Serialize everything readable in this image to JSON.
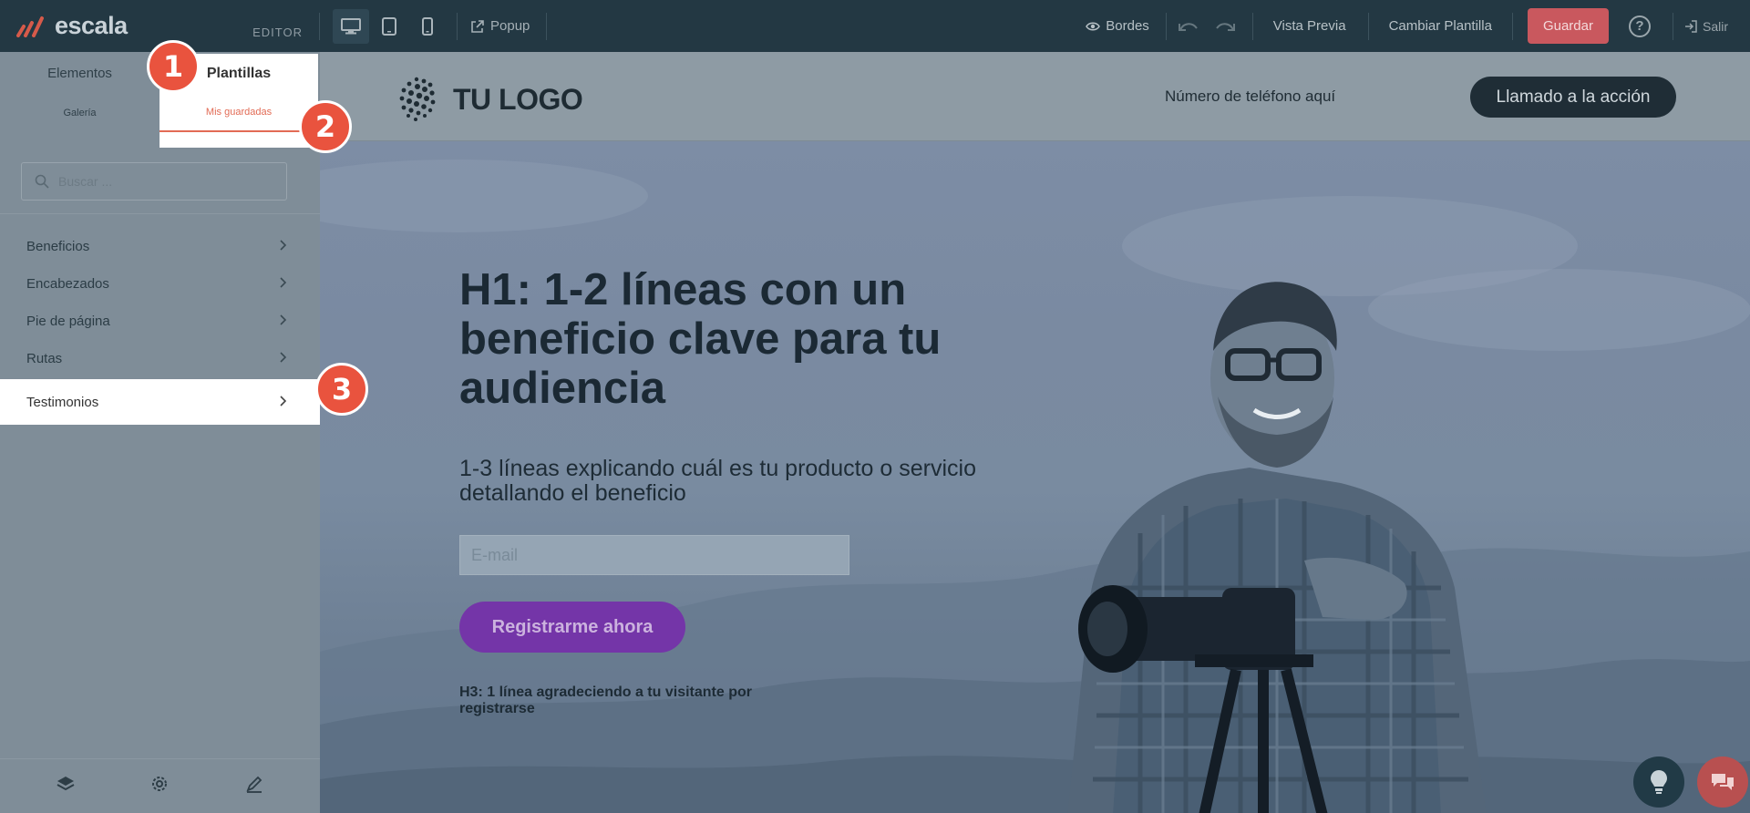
{
  "brand": {
    "name": "escala",
    "editor_label": "EDITOR"
  },
  "toolbar": {
    "devices": [
      "desktop-icon",
      "tablet-icon",
      "mobile-icon"
    ],
    "popup_label": "Popup",
    "borders_label": "Bordes",
    "preview_label": "Vista Previa",
    "change_template_label": "Cambiar Plantilla",
    "save_label": "Guardar",
    "help_label": "?",
    "exit_label": "Salir",
    "save_color": "#c9585e"
  },
  "sidebar": {
    "tabs": [
      {
        "label": "Elementos"
      },
      {
        "label": "Plantillas",
        "active": true
      }
    ],
    "subtabs": [
      {
        "label": "Galería"
      },
      {
        "label": "Mis guardadas",
        "active": true
      }
    ],
    "search": {
      "placeholder": "Buscar ..."
    },
    "categories": [
      {
        "label": "Beneficios"
      },
      {
        "label": "Encabezados"
      },
      {
        "label": "Pie de página"
      },
      {
        "label": "Rutas"
      },
      {
        "label": "Testimonios",
        "active": true
      }
    ],
    "footer_icons": [
      "layers-icon",
      "gear-icon",
      "pen-icon"
    ]
  },
  "badges": [
    "1",
    "2",
    "3"
  ],
  "landing": {
    "logo_text": "TU LOGO",
    "phone": "Número de teléfono aquí",
    "cta": "Llamado a la acción",
    "h1": "H1: 1-2 líneas con un beneficio clave para tu audiencia",
    "subtitle": "1-3 líneas explicando cuál es tu producto o servicio detallando el beneficio",
    "email_placeholder": "E-mail",
    "register_button": "Registrarme ahora",
    "h3": "H3: 1 línea agradeciendo a tu visitante por registrarse",
    "button_color": "#7435a8"
  },
  "colors": {
    "accent": "#e9533e",
    "topbar": "#233843"
  }
}
